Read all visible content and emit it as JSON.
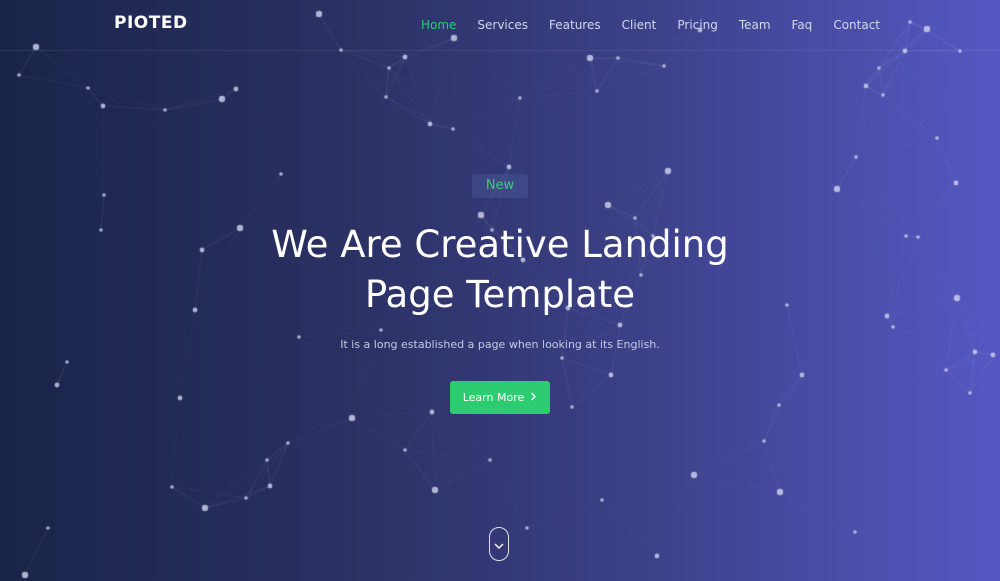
{
  "nav": {
    "logo": "PIOTED",
    "items": [
      {
        "label": "Home",
        "active": true
      },
      {
        "label": "Services",
        "active": false
      },
      {
        "label": "Features",
        "active": false
      },
      {
        "label": "Client",
        "active": false
      },
      {
        "label": "Pricing",
        "active": false
      },
      {
        "label": "Team",
        "active": false
      },
      {
        "label": "Faq",
        "active": false
      },
      {
        "label": "Contact",
        "active": false
      }
    ]
  },
  "hero": {
    "badge": "New",
    "title_line1": "We Are Creative Landing",
    "title_line2": "Page Template",
    "subtitle": "It is a long established a page when looking at its English.",
    "cta_label": "Learn More",
    "cta_icon": "chevron-right-icon",
    "scroll_icon": "chevron-down-icon"
  },
  "colors": {
    "accent": "#2ecc71",
    "gradient_start": "#1a2449",
    "gradient_end": "#5558c2"
  }
}
